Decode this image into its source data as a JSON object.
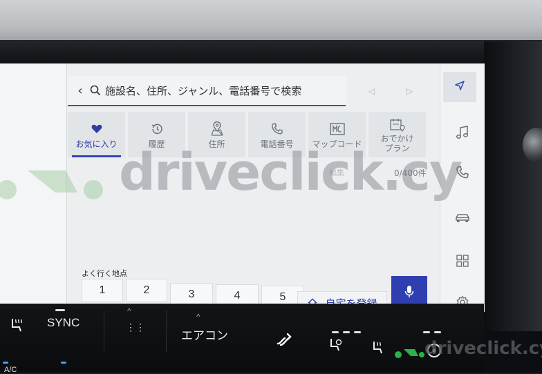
{
  "search": {
    "placeholder": "施設名、住所、ジャンル、電話番号で検索",
    "back_icon": "chevron-left-icon",
    "search_icon": "magnifier-icon"
  },
  "nav_arrows": {
    "prev_icon": "triangle-left-icon",
    "next_icon": "triangle-right-icon"
  },
  "tabs": [
    {
      "label": "お気に入り",
      "icon": "heart-icon",
      "active": true
    },
    {
      "label": "履歴",
      "icon": "history-icon",
      "active": false
    },
    {
      "label": "住所",
      "icon": "map-pin-icon",
      "active": false
    },
    {
      "label": "電話番号",
      "icon": "phone-icon",
      "active": false
    },
    {
      "label": "マップコード",
      "icon": "mapcode-icon",
      "active": false
    },
    {
      "label": "おでかけ\nプラン",
      "icon": "calendar-pin-icon",
      "active": false
    }
  ],
  "favorites": {
    "counter": "0/400件",
    "edit_label": "編集"
  },
  "frequent": {
    "label": "よく行く地点",
    "slots": [
      "1",
      "2",
      "3",
      "4",
      "5"
    ],
    "register_label": "自宅を登録"
  },
  "sidebar": [
    "navigation-arrow-icon",
    "music-note-icon",
    "phone-icon",
    "car-icon",
    "apps-grid-icon",
    "gear-icon"
  ],
  "climate": {
    "sync": "SYNC",
    "aircon": "エアコン",
    "ac": "A/C"
  },
  "watermark": {
    "text": "driveclick.cy"
  },
  "colors": {
    "accent": "#3346b8",
    "screen_bg": "#eceef0",
    "tab_bg": "#e2e5e8",
    "mic_bg": "#2f3fb0"
  }
}
